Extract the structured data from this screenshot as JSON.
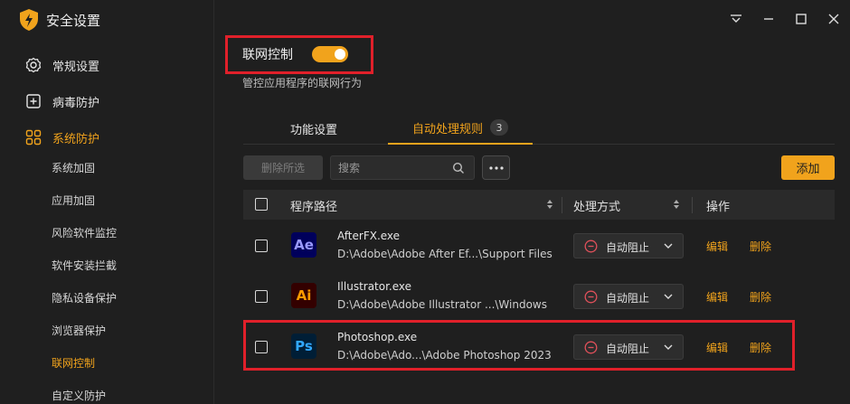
{
  "app": {
    "title": "安全设置"
  },
  "sidebar": {
    "items": [
      {
        "label": "常规设置",
        "icon": "gear-icon"
      },
      {
        "label": "病毒防护",
        "icon": "plus-square-icon"
      },
      {
        "label": "系统防护",
        "icon": "grid-icon",
        "active": true
      }
    ],
    "sub_items": [
      {
        "label": "系统加固"
      },
      {
        "label": "应用加固"
      },
      {
        "label": "风险软件监控"
      },
      {
        "label": "软件安装拦截"
      },
      {
        "label": "隐私设备保护"
      },
      {
        "label": "浏览器保护"
      },
      {
        "label": "联网控制",
        "active": true
      },
      {
        "label": "自定义防护"
      }
    ]
  },
  "window_controls": [
    "menu-icon",
    "minimize-icon",
    "maximize-icon",
    "close-icon"
  ],
  "network": {
    "title": "联网控制",
    "enabled": true,
    "description": "管控应用程序的联网行为"
  },
  "tabs": [
    {
      "label": "功能设置"
    },
    {
      "label": "自动处理规则",
      "badge": "3",
      "active": true
    }
  ],
  "toolbar": {
    "delete_selected": "删除所选",
    "search_placeholder": "搜索",
    "add": "添加"
  },
  "table": {
    "headers": {
      "path": "程序路径",
      "handle": "处理方式",
      "ops": "操作"
    },
    "rows": [
      {
        "icon_text": "Ae",
        "icon_color": "#9999ff",
        "icon_bg": "#00005b",
        "name": "AfterFX.exe",
        "path": "D:\\Adobe\\Adobe After Ef...\\Support Files",
        "handle": "自动阻止",
        "edit": "编辑",
        "delete": "删除"
      },
      {
        "icon_text": "Ai",
        "icon_color": "#ff9a00",
        "icon_bg": "#330000",
        "name": "Illustrator.exe",
        "path": "D:\\Adobe\\Adobe Illustrator ...\\Windows",
        "handle": "自动阻止",
        "edit": "编辑",
        "delete": "删除"
      },
      {
        "icon_text": "Ps",
        "icon_color": "#31a8ff",
        "icon_bg": "#001e36",
        "name": "Photoshop.exe",
        "path": "D:\\Adobe\\Ado...\\Adobe Photoshop 2023",
        "handle": "自动阻止",
        "edit": "编辑",
        "delete": "删除"
      }
    ]
  },
  "colors": {
    "accent": "#f1a31c",
    "highlight": "#e0202a",
    "background": "#1f1f1f"
  }
}
